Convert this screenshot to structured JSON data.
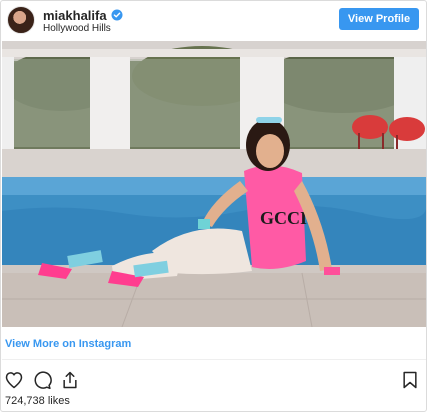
{
  "header": {
    "username": "miakhalifa",
    "verified_icon": "verified-badge-icon",
    "location": "Hollywood Hills",
    "view_profile_label": "View Profile"
  },
  "photo": {
    "description_icon": "post-photo"
  },
  "footer": {
    "view_more_label": "View More on Instagram",
    "likes_text": "724,738 likes"
  },
  "actions": {
    "like_icon": "heart-icon",
    "comment_icon": "comment-icon",
    "share_icon": "share-icon",
    "save_icon": "bookmark-icon"
  },
  "colors": {
    "accent": "#3897f0",
    "text": "#262626",
    "border": "#dbdbdb"
  }
}
